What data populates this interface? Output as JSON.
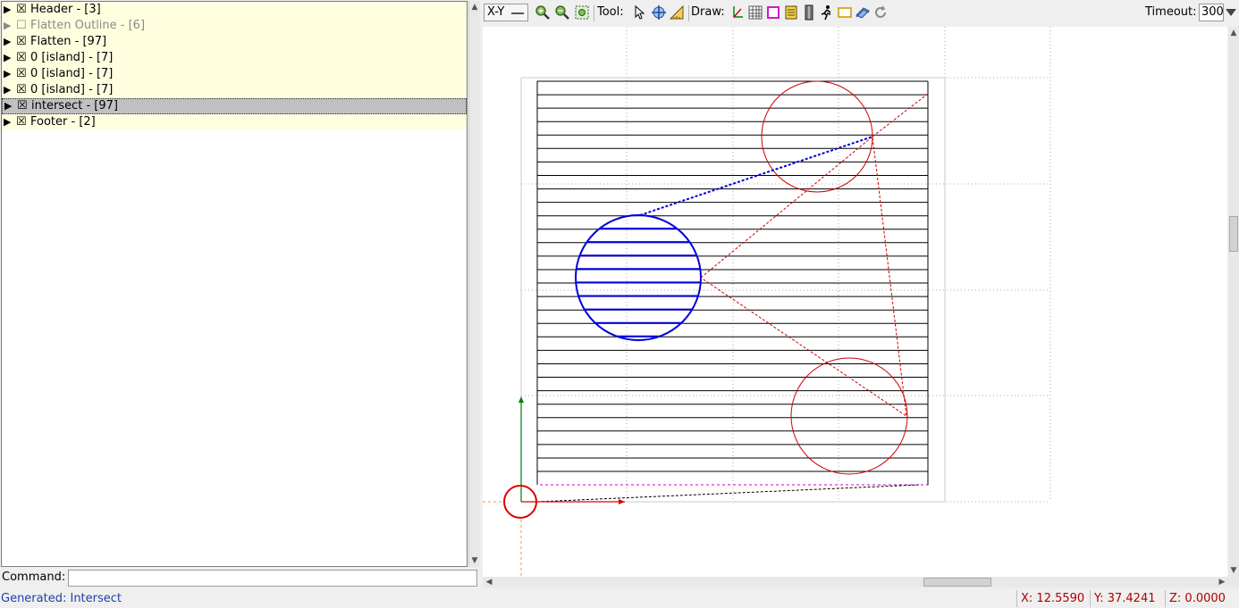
{
  "tree": {
    "items": [
      {
        "label": "Header - [3]",
        "checked": true,
        "state": "normal"
      },
      {
        "label": "Flatten Outline - [6]",
        "checked": false,
        "state": "disabled"
      },
      {
        "label": "Flatten - [97]",
        "checked": true,
        "state": "normal"
      },
      {
        "label": "0 [island] - [7]",
        "checked": true,
        "state": "normal"
      },
      {
        "label": "0 [island] - [7]",
        "checked": true,
        "state": "normal"
      },
      {
        "label": "0 [island] - [7]",
        "checked": true,
        "state": "normal"
      },
      {
        "label": "intersect - [97]",
        "checked": true,
        "state": "selected"
      },
      {
        "label": "Footer - [2]",
        "checked": true,
        "state": "normal"
      }
    ],
    "expand_glyph": "▶",
    "checked_glyph": "☒",
    "unchecked_glyph": "☐"
  },
  "command": {
    "label": "Command:",
    "value": ""
  },
  "status": {
    "message": "Generated: Intersect",
    "x": "X: 12.5590",
    "y": "Y: 37.4241",
    "z": "Z: 0.0000"
  },
  "toolbar": {
    "view": "X-Y",
    "tool_label": "Tool:",
    "draw_label": "Draw:",
    "timeout_label": "Timeout:",
    "timeout_value": "300"
  },
  "colors": {
    "toolpath": "#000000",
    "island": "#cc0000",
    "active": "#0000dd",
    "margin": "#cc00cc",
    "axis_x": "#dd0000",
    "axis_y": "#008000",
    "grid": "#999999",
    "gantry": "#ff9900"
  }
}
